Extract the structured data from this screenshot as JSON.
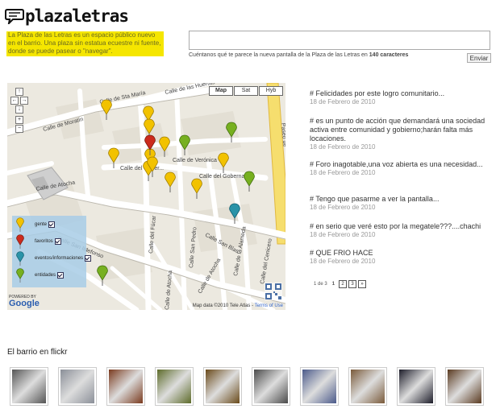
{
  "header": {
    "logo_text": "plazaletras",
    "intro": "La Plaza de las Letras es un espacio público nuevo en el barrio. Una plaza sin estatua ecuestre ni fuente, donde se puede pasear o \"navegar\"."
  },
  "compose": {
    "placeholder": "",
    "hint_prefix": "Cuéntanos qué te parece la nueva pantalla de la Plaza de las Letras en",
    "hint_count": "140 caracteres",
    "send_label": "Enviar"
  },
  "map": {
    "type_buttons": [
      "Map",
      "Sat",
      "Hyb"
    ],
    "selected_type": "Map",
    "zoom_controls": [
      "↑",
      "←",
      "→",
      "↓",
      "+",
      "−"
    ],
    "streets": [
      "Calle de las Huertas",
      "Calle de Sta María",
      "Calle de Moratín",
      "Calle de Verónica",
      "Calle del Gobernador",
      "Calle de Atocha",
      "Calle San Ildefonso",
      "Calle del Fúcar",
      "Calle San Pedro",
      "Calle San Blas",
      "Calle de la Alameda",
      "Calle del Cenicero",
      "Paseo de"
    ],
    "legend": [
      {
        "label": "gente",
        "color": "#f2c200"
      },
      {
        "label": "favoritos",
        "color": "#cc2b1d"
      },
      {
        "label": "eventos/informaciones",
        "color": "#2a93a8"
      },
      {
        "label": "entidades",
        "color": "#77b020"
      }
    ],
    "powered_by": "POWERED BY",
    "google": "Google",
    "attribution": "Map data ©2010 Tele Atlas -",
    "terms": "Terms of Use"
  },
  "posts": [
    {
      "text": "# Felicidades por este logro comunitario...",
      "date": "18 de Febrero de 2010"
    },
    {
      "text": "# es un punto de acción que demandará una sociedad activa entre comunidad y gobierno;harán falta más locaciones.",
      "date": "18 de Febrero de 2010"
    },
    {
      "text": "# Foro inagotable,una voz abierta es una necesidad...",
      "date": "18 de Febrero de 2010"
    },
    {
      "text": "# Tengo que pasarme a ver la pantalla...",
      "date": "18 de Febrero de 2010"
    },
    {
      "text": "# en serio que veré esto por la megatele???....chachi",
      "date": "18 de Febrero de 2010"
    },
    {
      "text": "# QUE FRIO HACE",
      "date": "18 de Febrero de 2010"
    }
  ],
  "pager": {
    "label": "1 de 3",
    "current": "1",
    "pages": [
      "2",
      "3",
      "»"
    ]
  },
  "flickr": {
    "title": "El barrio en flickr",
    "thumb_colors": [
      "#555555",
      "#8a8f98",
      "#7a3a1e",
      "#5d6b2a",
      "#6a4a1a",
      "#4a4a4a",
      "#4b5a8a",
      "#7a5a3a",
      "#1d1d2a",
      "#5a3a20"
    ]
  }
}
